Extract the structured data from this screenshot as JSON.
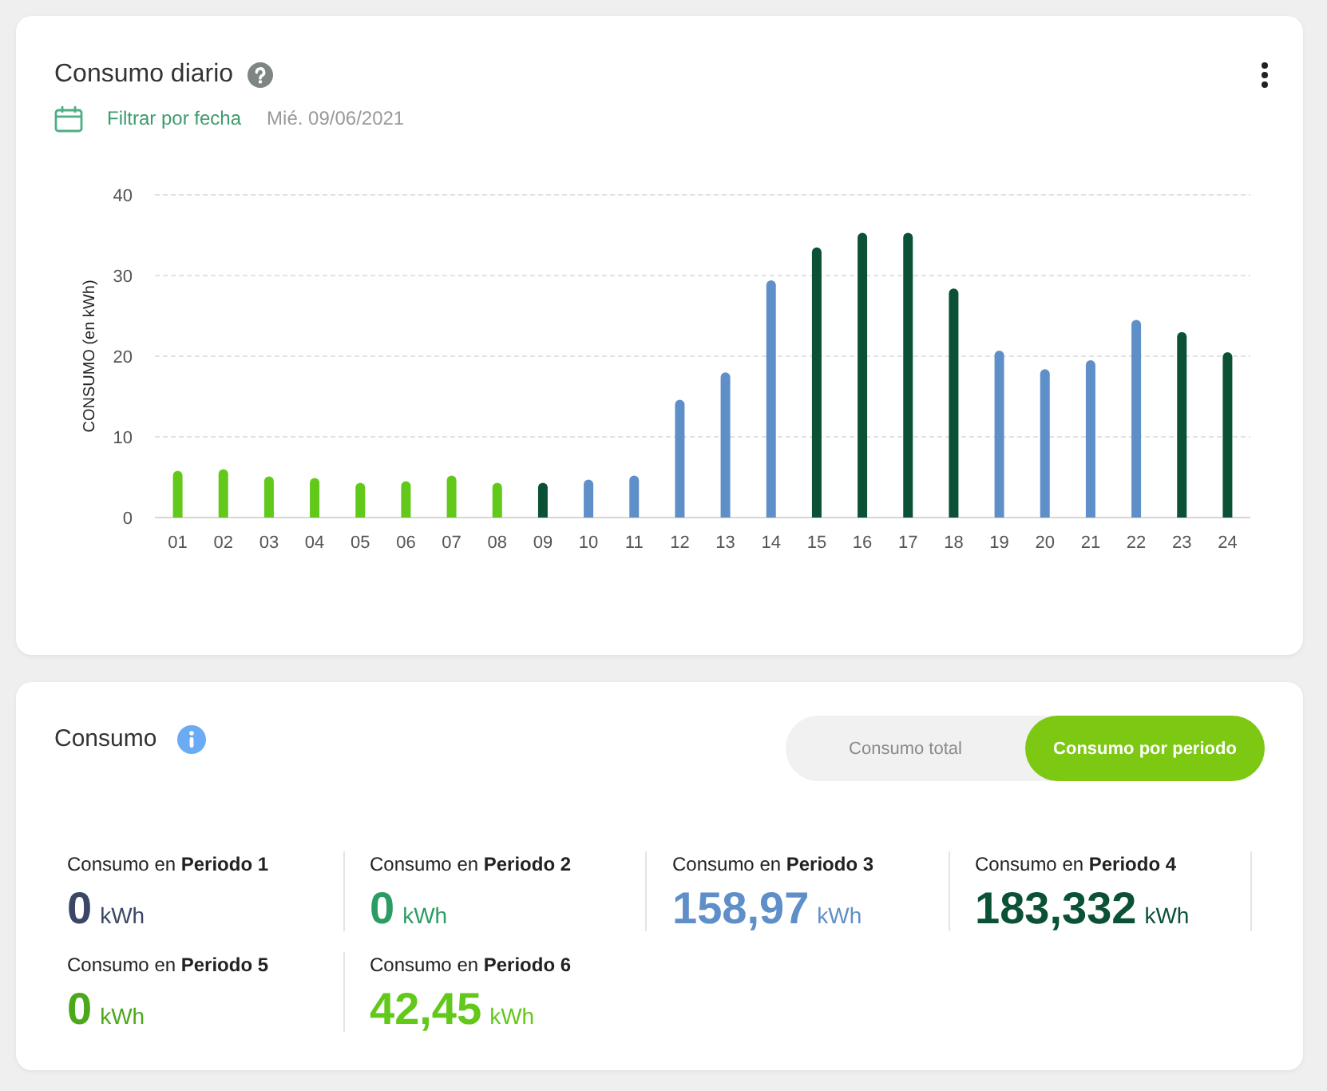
{
  "daily_card": {
    "title": "Consumo diario",
    "filter": {
      "link": "Filtrar por fecha",
      "date": "Mié. 09/06/2021"
    },
    "chart_data": {
      "type": "bar",
      "ylabel": "CONSUMO (en kWh)",
      "categories": [
        "01",
        "02",
        "03",
        "04",
        "05",
        "06",
        "07",
        "08",
        "09",
        "10",
        "11",
        "12",
        "13",
        "14",
        "15",
        "16",
        "17",
        "18",
        "19",
        "20",
        "21",
        "22",
        "23",
        "24"
      ],
      "series": [
        {
          "color": "#62c81a",
          "values": [
            5.8,
            6.0,
            5.1,
            4.9,
            4.3,
            4.5,
            5.2,
            4.3,
            null,
            null,
            null,
            null,
            null,
            null,
            null,
            null,
            null,
            null,
            null,
            null,
            null,
            null,
            null,
            null
          ]
        },
        {
          "color": "#5f8fc8",
          "values": [
            null,
            null,
            null,
            null,
            null,
            null,
            null,
            null,
            null,
            4.7,
            5.2,
            14.6,
            18.0,
            29.4,
            null,
            null,
            null,
            null,
            20.7,
            18.4,
            19.5,
            24.5,
            null,
            null
          ]
        },
        {
          "color": "#0a5136",
          "values": [
            null,
            null,
            null,
            null,
            null,
            null,
            null,
            null,
            4.3,
            null,
            null,
            null,
            null,
            null,
            33.5,
            35.3,
            35.3,
            28.4,
            null,
            null,
            null,
            null,
            23.0,
            20.5
          ]
        }
      ],
      "ylim": [
        0,
        40
      ],
      "yticks": [
        0,
        10,
        20,
        30,
        40
      ],
      "grid": true,
      "stacked": true
    }
  },
  "period_card": {
    "title": "Consumo",
    "view_toggle": [
      {
        "label": "Consumo total",
        "selected": false
      },
      {
        "label": "Consumo por periodo",
        "selected": true
      }
    ],
    "periods": [
      {
        "label": "Consumo en **Periodo 1**",
        "value": "0",
        "unit": "kWh",
        "color": "#3a4766"
      },
      {
        "label": "Consumo en **Periodo 2**",
        "value": "0",
        "unit": "kWh",
        "color": "#2b9c64"
      },
      {
        "label": "Consumo en **Periodo 3**",
        "value": "158,97",
        "unit": "kWh",
        "color": "#5f8fc8"
      },
      {
        "label": "Consumo en **Periodo 4**",
        "value": "183,332",
        "unit": "kWh",
        "color": "#0a5136"
      },
      {
        "label": "Consumo en **Periodo 5**",
        "value": "0",
        "unit": "kWh",
        "color": "#4ba81b"
      },
      {
        "label": "Consumo en **Periodo 6**",
        "value": "42,45",
        "unit": "kWh",
        "color": "#62c81a"
      }
    ]
  }
}
